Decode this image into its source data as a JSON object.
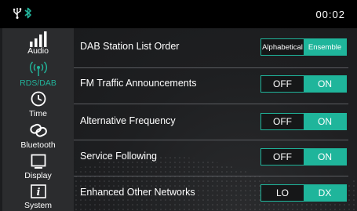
{
  "status": {
    "time": "00:02",
    "usb_icon": "usb-icon",
    "bt_icon": "bluetooth-status-icon",
    "bt_color": "#22b39a"
  },
  "sidebar": {
    "items": [
      {
        "label": "Audio",
        "icon": "equalizer-bars-icon"
      },
      {
        "label": "RDS/DAB",
        "icon": "radio-antenna-icon",
        "active": true
      },
      {
        "label": "Time",
        "icon": "clock-icon"
      },
      {
        "label": "Bluetooth",
        "icon": "bluetooth-link-icon"
      },
      {
        "label": "Display",
        "icon": "display-icon"
      },
      {
        "label": "System",
        "icon": "info-icon"
      }
    ]
  },
  "settings": [
    {
      "label": "DAB Station List Order",
      "options": [
        "Alphabetical",
        "Ensemble"
      ],
      "selected": 1
    },
    {
      "label": "FM Traffic Announcements",
      "options": [
        "OFF",
        "ON"
      ],
      "selected": 1
    },
    {
      "label": "Alternative Frequency",
      "options": [
        "OFF",
        "ON"
      ],
      "selected": 1
    },
    {
      "label": "Service Following",
      "options": [
        "OFF",
        "ON"
      ],
      "selected": 1
    },
    {
      "label": "Enhanced Other Networks",
      "options": [
        "LO",
        "DX"
      ],
      "selected": 1
    }
  ],
  "colors": {
    "accent": "#1fb59b",
    "background": "#1c1d1f",
    "sidebar": "#2b2c2e"
  }
}
